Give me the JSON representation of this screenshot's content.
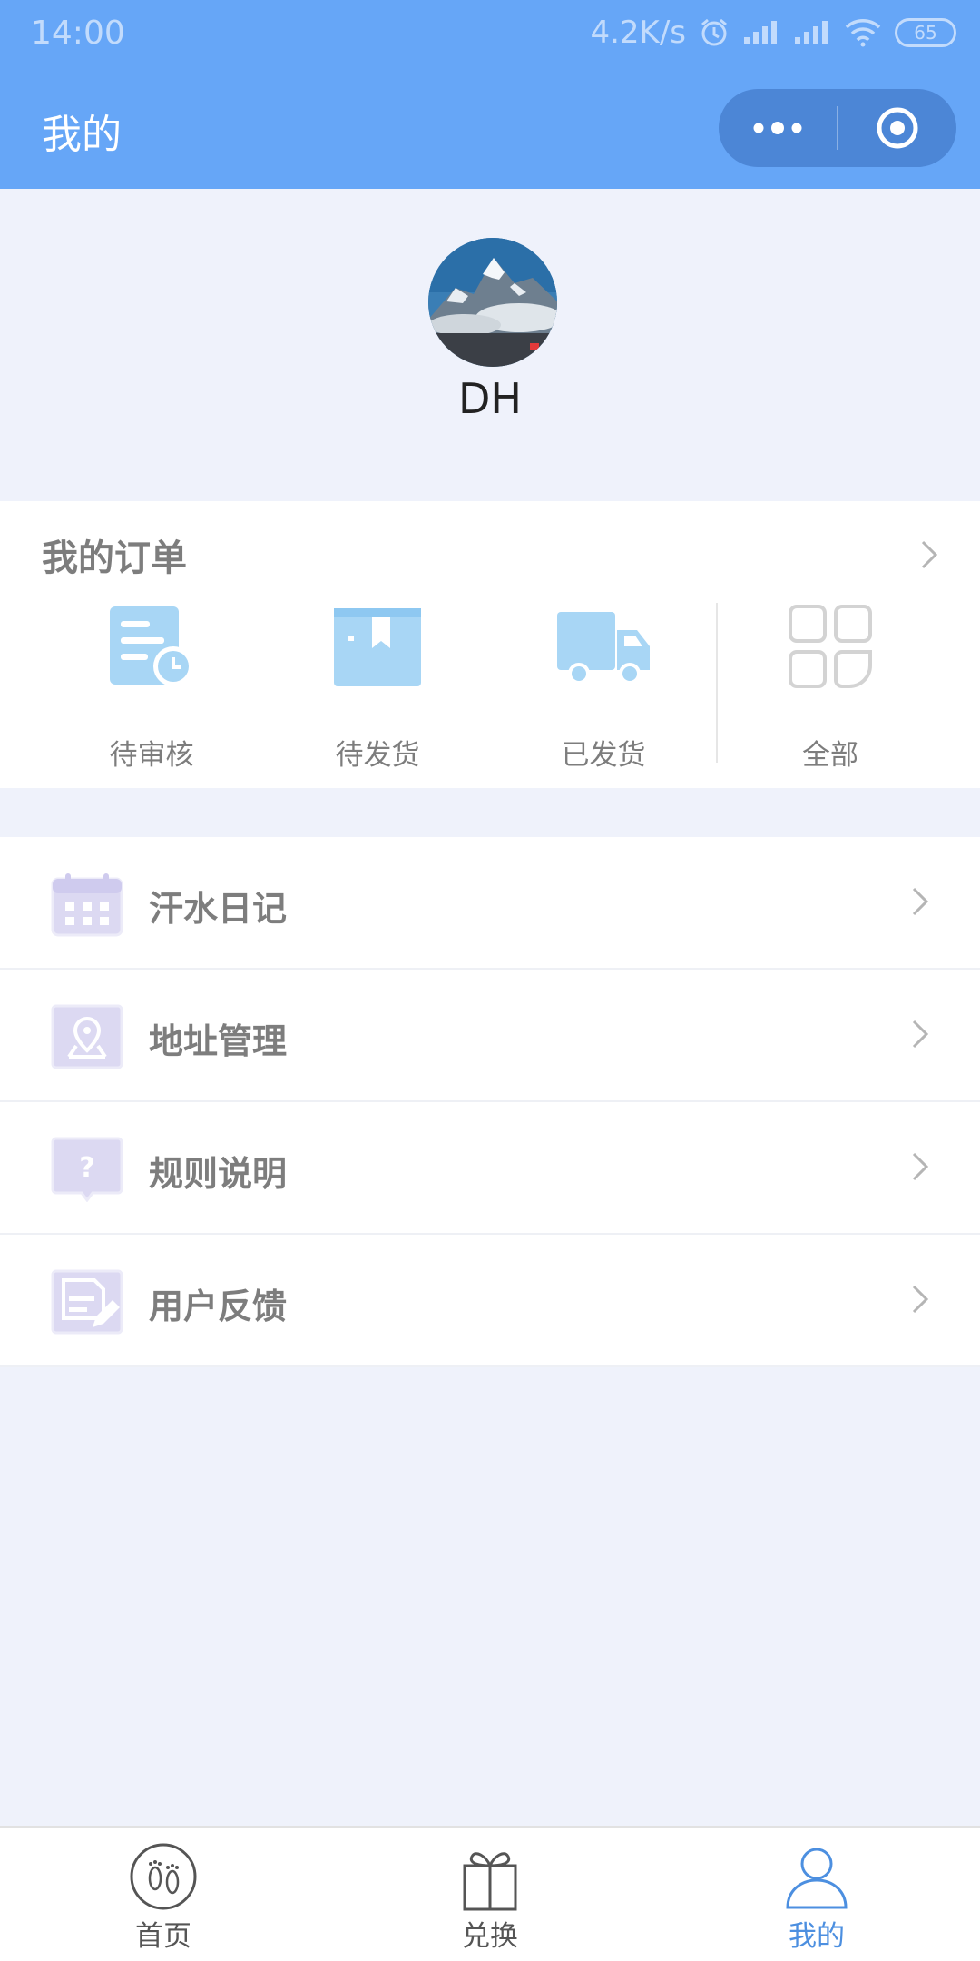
{
  "status_bar": {
    "time": "14:00",
    "speed": "4.2K/s",
    "battery": "65"
  },
  "nav": {
    "title": "我的"
  },
  "profile": {
    "username": "DH"
  },
  "orders": {
    "title": "我的订单",
    "items": [
      {
        "label": "待审核",
        "icon": "pending-review-icon"
      },
      {
        "label": "待发货",
        "icon": "to-ship-box-icon"
      },
      {
        "label": "已发货",
        "icon": "shipped-truck-icon"
      },
      {
        "label": "全部",
        "icon": "all-grid-icon"
      }
    ]
  },
  "menu": [
    {
      "label": "汗水日记",
      "icon": "calendar-icon"
    },
    {
      "label": "地址管理",
      "icon": "location-icon"
    },
    {
      "label": "规则说明",
      "icon": "question-icon"
    },
    {
      "label": "用户反馈",
      "icon": "feedback-icon"
    }
  ],
  "tabbar": [
    {
      "label": "首页",
      "icon": "footprint-icon"
    },
    {
      "label": "兑换",
      "icon": "gift-icon"
    },
    {
      "label": "我的",
      "icon": "user-icon",
      "active": true
    }
  ],
  "colors": {
    "header": "#66a6f7",
    "accent": "#4c8fe0",
    "order_icon": "#a8d6f5",
    "menu_icon": "#dcd9f2"
  }
}
